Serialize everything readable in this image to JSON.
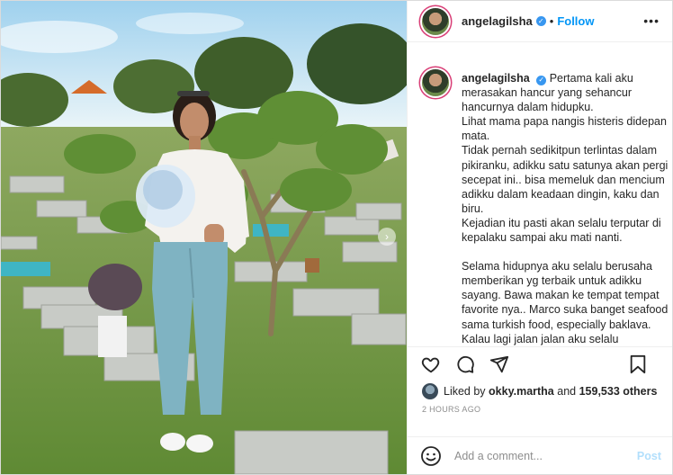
{
  "header": {
    "username": "angelagilsha",
    "dot": "•",
    "follow_label": "Follow",
    "more_label": "•••"
  },
  "caption": {
    "username": "angelagilsha",
    "paragraphs": [
      "Pertama kali aku merasakan hancur yang sehancur hancurnya dalam hidupku.",
      "Lihat mama papa nangis histeris didepan mata.",
      "Tidak pernah sedikitpun terlintas dalam pikiranku, adikku satu satunya akan pergi secepat ini.. bisa memeluk dan mencium adikku dalam keadaan dingin, kaku dan biru.",
      "Kejadian itu pasti akan selalu terputar di kepalaku sampai aku mati nanti.",
      "",
      "Selama hidupnya aku selalu berusaha memberikan yg terbaik untuk adikku sayang. Bawa makan ke tempat tempat favorite nya.. Marco suka banget seafood sama turkish food, especially baklava.",
      "Kalau lagi jalan jalan aku selalu"
    ]
  },
  "likes": {
    "prefix": "Liked by",
    "user": "okky.martha",
    "middle": "and",
    "count": "159,533 others"
  },
  "timestamp": "2 HOURS AGO",
  "comment": {
    "placeholder": "Add a comment...",
    "post_label": "Post"
  },
  "photo": {
    "carousel_next_icon": "›"
  },
  "icons": {
    "like": "heart-icon",
    "comment": "comment-bubble-icon",
    "share": "paper-plane-icon",
    "save": "bookmark-icon",
    "verified": "verified-badge-icon",
    "emoji": "smiley-icon"
  },
  "colors": {
    "follow": "#0095f6",
    "verified": "#3897f0",
    "post_disabled": "#b2dffc",
    "story_ring": "#d93f77"
  }
}
